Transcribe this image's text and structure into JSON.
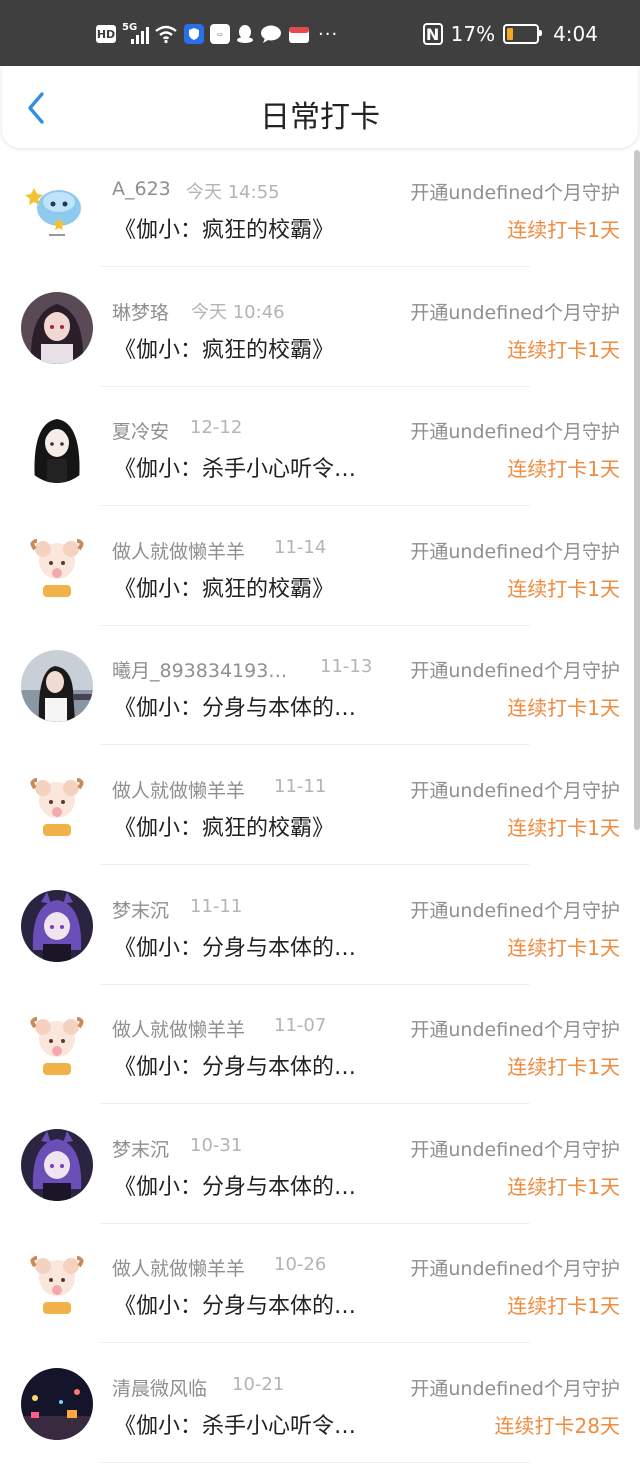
{
  "status_bar": {
    "hd": "HD",
    "network": "5G",
    "battery_percent": "17%",
    "time": "4:04",
    "battery_level": 0.17,
    "icons": [
      "hd-icon",
      "signal-icon",
      "wifi-icon",
      "shield-icon",
      "huawei-icon",
      "qq-icon",
      "chat-icon",
      "gift-icon",
      "more-icon",
      "nfc-icon",
      "battery-icon"
    ]
  },
  "header": {
    "title": "日常打卡"
  },
  "accent_color": "#f08a3c",
  "items": [
    {
      "name": "A_623",
      "date": "今天 14:55",
      "book": "《伽小：疯狂的校霸》",
      "guard": "开通undefined个月守护",
      "streak": "连续打卡1天",
      "avatar": "blue-cartoon"
    },
    {
      "name": "琳梦珞",
      "date": "今天 10:46",
      "book": "《伽小：疯狂的校霸》",
      "guard": "开通undefined个月守护",
      "streak": "连续打卡1天",
      "avatar": "anime-dark-hair"
    },
    {
      "name": "夏冷安",
      "date": "12-12",
      "book": "《伽小：杀手小心听令…",
      "guard": "开通undefined个月守护",
      "streak": "连续打卡1天",
      "avatar": "anime-black-hair"
    },
    {
      "name": "做人就做懒羊羊",
      "date": "11-14",
      "book": "《伽小：疯狂的校霸》",
      "guard": "开通undefined个月守护",
      "streak": "连续打卡1天",
      "avatar": "sheep"
    },
    {
      "name": "曦月_893834193…",
      "date": "11-13",
      "book": "《伽小：分身与本体的…",
      "guard": "开通undefined个月守护",
      "streak": "连续打卡1天",
      "avatar": "girl-photo"
    },
    {
      "name": "做人就做懒羊羊",
      "date": "11-11",
      "book": "《伽小：疯狂的校霸》",
      "guard": "开通undefined个月守护",
      "streak": "连续打卡1天",
      "avatar": "sheep"
    },
    {
      "name": "梦末沉",
      "date": "11-11",
      "book": "《伽小：分身与本体的…",
      "guard": "开通undefined个月守护",
      "streak": "连续打卡1天",
      "avatar": "anime-purple"
    },
    {
      "name": "做人就做懒羊羊",
      "date": "11-07",
      "book": "《伽小：分身与本体的…",
      "guard": "开通undefined个月守护",
      "streak": "连续打卡1天",
      "avatar": "sheep"
    },
    {
      "name": "梦末沉",
      "date": "10-31",
      "book": "《伽小：分身与本体的…",
      "guard": "开通undefined个月守护",
      "streak": "连续打卡1天",
      "avatar": "anime-purple"
    },
    {
      "name": "做人就做懒羊羊",
      "date": "10-26",
      "book": "《伽小：分身与本体的…",
      "guard": "开通undefined个月守护",
      "streak": "连续打卡1天",
      "avatar": "sheep"
    },
    {
      "name": "清晨微风临",
      "date": "10-21",
      "book": "《伽小：杀手小心听令…",
      "guard": "开通undefined个月守护",
      "streak": "连续打卡28天",
      "avatar": "night-photo"
    }
  ]
}
